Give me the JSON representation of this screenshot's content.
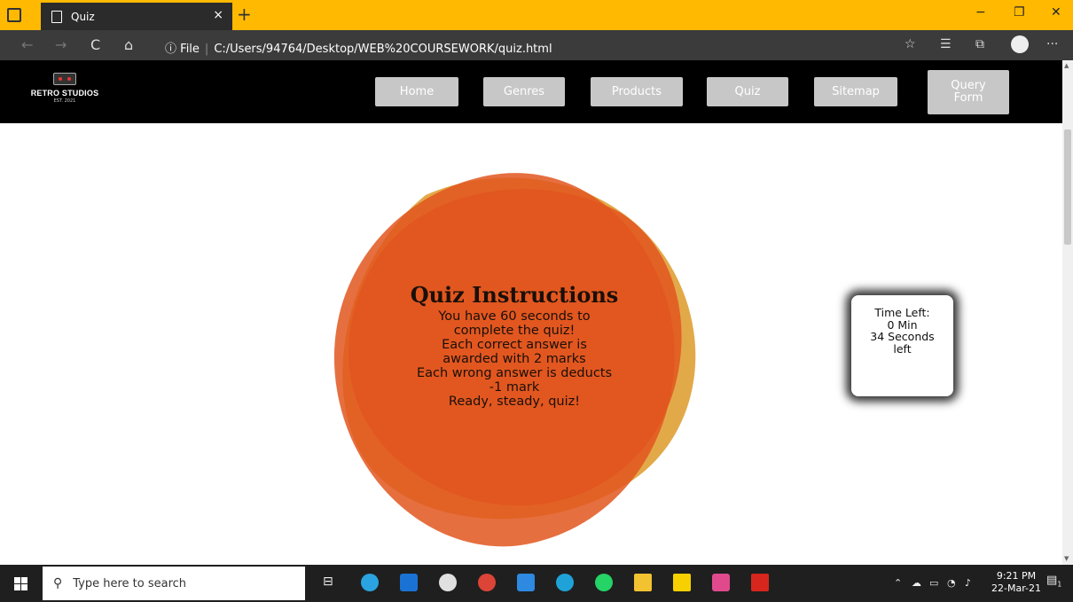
{
  "browser": {
    "tab_title": "Quiz",
    "tab_close": "×",
    "new_tab": "+",
    "url_prefix": "File",
    "url": "C:/Users/94764/Desktop/WEB%20COURSEWORK/quiz.html",
    "info_icon": "ⓘ",
    "back": "←",
    "forward": "→",
    "refresh": "C",
    "home": "⌂",
    "menu": "···",
    "minimize": "−",
    "restore": "❐",
    "close": "✕"
  },
  "site": {
    "logo_name": "RETRO STUDIOS",
    "logo_est": "EST. 2021",
    "nav": [
      {
        "label": "Home"
      },
      {
        "label": "Genres"
      },
      {
        "label": "Products"
      },
      {
        "label": "Quiz"
      },
      {
        "label": "Sitemap"
      },
      {
        "label": "Query Form"
      }
    ]
  },
  "instructions": {
    "title": "Quiz Instructions",
    "lines": [
      "You have 60 seconds to",
      "complete the quiz!",
      "Each correct answer is",
      "awarded with 2 marks",
      "Each wrong answer is deducts",
      "-1 mark",
      "Ready, steady, quiz!"
    ]
  },
  "timer": {
    "lines": [
      "Time Left:",
      "0 Min",
      "34 Seconds",
      "left"
    ]
  },
  "taskbar": {
    "search_placeholder": "Type here to search",
    "time": "9:21 PM",
    "date": "22-Mar-21",
    "notification_count": "1"
  },
  "colors": {
    "tabstrip": "#ffb900",
    "header_bg": "#000000",
    "nav_button": "#c7c7c7",
    "blob_orange": "#e2561e",
    "blob_amber": "#e0a23a"
  }
}
